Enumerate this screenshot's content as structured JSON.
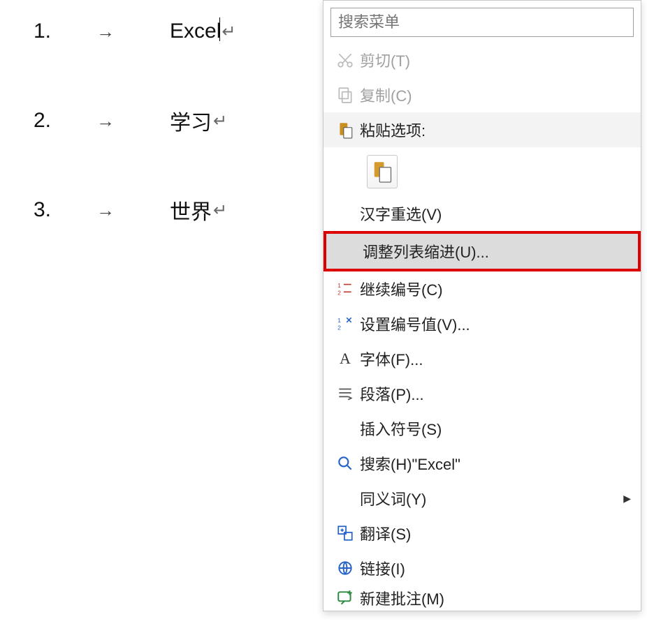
{
  "document": {
    "lines": [
      {
        "num": "1.",
        "text": "Excel"
      },
      {
        "num": "2.",
        "text": "学习"
      },
      {
        "num": "3.",
        "text": "世界"
      }
    ],
    "tab_arrow": "→",
    "para_mark": "↵"
  },
  "menu": {
    "search_placeholder": "搜索菜单",
    "cut": "剪切(T)",
    "copy": "复制(C)",
    "paste_header": "粘贴选项:",
    "reconvert": "汉字重选(V)",
    "adjust_indent": "调整列表缩进(U)...",
    "continue_number": "继续编号(C)",
    "set_number_value": "设置编号值(V)...",
    "font": "字体(F)...",
    "paragraph": "段落(P)...",
    "insert_symbol": "插入符号(S)",
    "search_label": "搜索(H)\"Excel\"",
    "synonyms": "同义词(Y)",
    "translate": "翻译(S)",
    "link": "链接(I)",
    "new_comment": "新建批注(M)"
  }
}
